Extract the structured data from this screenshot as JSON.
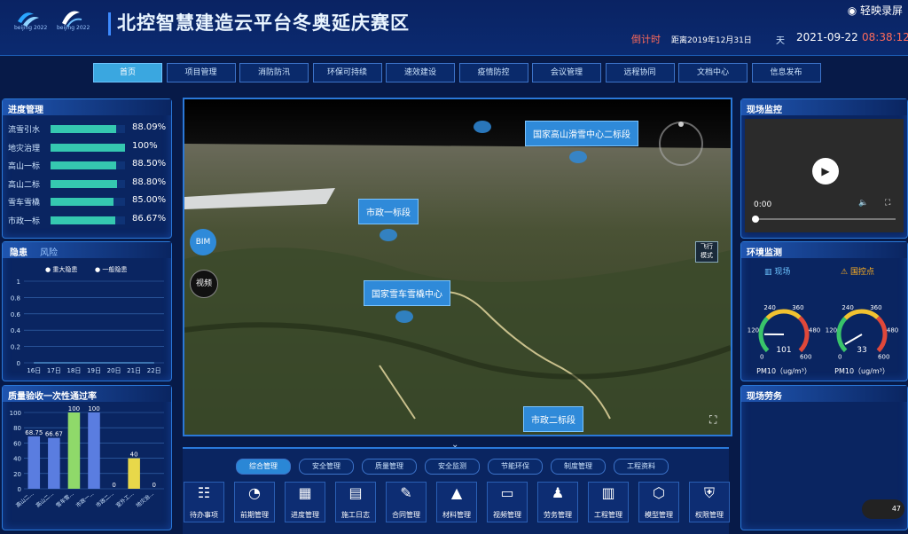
{
  "header": {
    "logo1_text": "beijing 2022",
    "logo2_text": "beijing 2022",
    "title": "北控智慧建造云平台冬奥延庆赛区",
    "recording": "轻映录屏",
    "countdown_label": "倒计时",
    "distance_text": "距离2019年12月31日",
    "day_label": "天",
    "date": "2021-09-22",
    "time": "08:38:12"
  },
  "nav": [
    "首页",
    "项目管理",
    "消防防汛",
    "环保可持续",
    "速效建设",
    "疫情防控",
    "会议管理",
    "远程协同",
    "文档中心",
    "信息发布"
  ],
  "progress": {
    "title": "进度管理",
    "items": [
      {
        "label": "流雪引水",
        "value": "88.09%",
        "fill": 88.09
      },
      {
        "label": "地灾治理",
        "value": "100%",
        "fill": 100
      },
      {
        "label": "高山一标",
        "value": "88.50%",
        "fill": 88.5
      },
      {
        "label": "高山二标",
        "value": "88.80%",
        "fill": 88.8
      },
      {
        "label": "雪车雪橇",
        "value": "85.00%",
        "fill": 85
      },
      {
        "label": "市政一标",
        "value": "86.67%",
        "fill": 86.67
      }
    ]
  },
  "risk": {
    "tab1": "隐患",
    "tab2": "风险",
    "legend1": "重大隐患",
    "legend2": "一般隐患",
    "chart_data": {
      "type": "line",
      "x": [
        "16日",
        "17日",
        "18日",
        "19日",
        "20日",
        "21日",
        "22日"
      ],
      "yticks": [
        "0",
        "0.2",
        "0.4",
        "0.6",
        "0.8",
        "1"
      ],
      "ylim": [
        0,
        1
      ],
      "series": [
        {
          "name": "重大隐患",
          "values": [
            0,
            0,
            0,
            0,
            0,
            0,
            0
          ]
        },
        {
          "name": "一般隐患",
          "values": [
            0,
            0,
            0,
            0,
            0,
            0,
            0
          ]
        }
      ]
    }
  },
  "quality": {
    "title": "质量验收一次性通过率",
    "chart_data": {
      "type": "bar",
      "categories": [
        "高山二...",
        "高山二...",
        "雪车雪...",
        "市政一...",
        "市政二...",
        "室外工...",
        "地灾治..."
      ],
      "values": [
        68.75,
        66.67,
        100,
        100,
        0,
        40,
        0
      ],
      "labels": [
        "68.75",
        "66.67",
        "100",
        "100",
        "0",
        "40",
        "0"
      ],
      "colors": [
        "#5a7de0",
        "#5a7de0",
        "#8fd96a",
        "#5a7de0",
        "#5a7de0",
        "#e8d84a",
        "#5a7de0"
      ],
      "yticks": [
        "0",
        "20",
        "40",
        "60",
        "80",
        "100"
      ],
      "ylim": [
        0,
        100
      ]
    }
  },
  "map": {
    "markers": [
      "国家高山滑雪中心二标段",
      "市政一标段",
      "国家雪车雪橇中心",
      "市政二标段"
    ],
    "bim_button": "BIM",
    "video_button": "视频",
    "fly_mode": "飞行\n模式"
  },
  "monitor": {
    "title": "现场监控",
    "time": "0:00"
  },
  "env": {
    "title": "环境监测",
    "site_label": "现场",
    "control_label": "国控点",
    "gauges": [
      {
        "value": "101",
        "level": 101,
        "unit": "PM10（ug/m³）",
        "ticks": [
          "0",
          "120",
          "240",
          "360",
          "480",
          "600"
        ]
      },
      {
        "value": "33",
        "level": 33,
        "unit": "PM10（ug/m³）",
        "ticks": [
          "0",
          "120",
          "240",
          "360",
          "480",
          "600"
        ]
      }
    ]
  },
  "labor": {
    "title": "现场劳务"
  },
  "bottom": {
    "tabs": [
      "综合管理",
      "安全管理",
      "质量管理",
      "安全监测",
      "节能环保",
      "制度管理",
      "工程资料"
    ],
    "tools": [
      {
        "label": "待办事项",
        "icon": "todo-icon",
        "glyph": "☷"
      },
      {
        "label": "前期管理",
        "icon": "pie-icon",
        "glyph": "◔"
      },
      {
        "label": "进度管理",
        "icon": "calendar-icon",
        "glyph": "▦"
      },
      {
        "label": "施工日志",
        "icon": "clipboard-icon",
        "glyph": "▤"
      },
      {
        "label": "合同管理",
        "icon": "contract-icon",
        "glyph": "✎"
      },
      {
        "label": "材料管理",
        "icon": "material-icon",
        "glyph": "▲"
      },
      {
        "label": "视频管理",
        "icon": "video-icon",
        "glyph": "▭"
      },
      {
        "label": "劳务管理",
        "icon": "worker-icon",
        "glyph": "♟"
      },
      {
        "label": "工程管理",
        "icon": "building-icon",
        "glyph": "▥"
      },
      {
        "label": "模型管理",
        "icon": "cube-icon",
        "glyph": "⬡"
      },
      {
        "label": "权限管理",
        "icon": "shield-icon",
        "glyph": "⛨"
      }
    ]
  },
  "speed_badge": "47"
}
